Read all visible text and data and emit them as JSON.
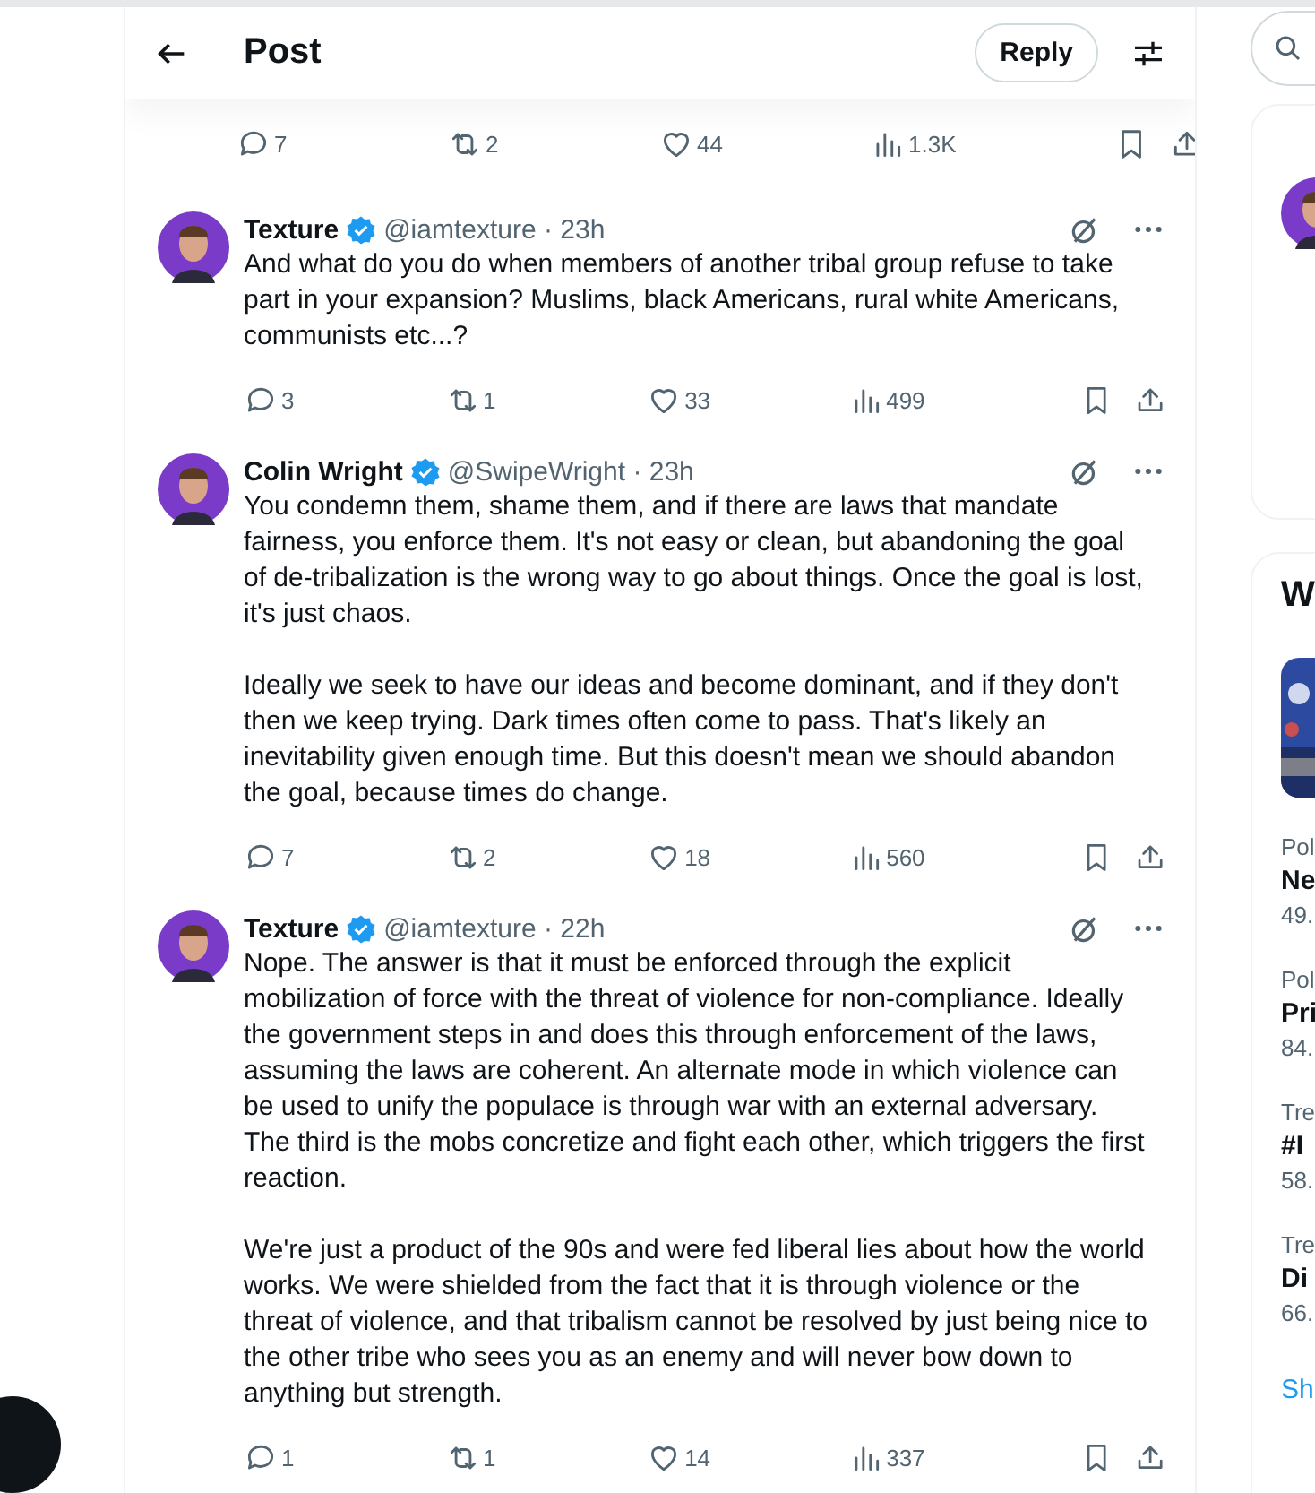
{
  "header": {
    "title": "Post",
    "reply_button": "Reply"
  },
  "tweets": [
    {
      "kind": "partial",
      "stats": {
        "replies": "7",
        "reposts": "2",
        "likes": "44",
        "views": "1.3K"
      }
    },
    {
      "kind": "full",
      "name": "Texture",
      "verified": true,
      "meta": "@iamtexture · 23h",
      "paragraphs": [
        "And what do you do when members of another tribal group refuse to take part in your expansion? Muslims, black Americans, rural white Americans, communists etc...?"
      ],
      "stats": {
        "replies": "3",
        "reposts": "1",
        "likes": "33",
        "views": "499"
      }
    },
    {
      "kind": "full",
      "name": "Colin Wright",
      "verified": true,
      "meta": "@SwipeWright · 23h",
      "paragraphs": [
        "You condemn them, shame them, and if there are laws that mandate fairness, you enforce them. It's not easy or clean, but abandoning the goal of de-tribalization is the wrong way to go about things. Once the goal is lost, it's just chaos.",
        "Ideally we seek to have our ideas and become dominant, and if they don't then we keep trying. Dark times often come to pass. That's likely an inevitability given enough time. But this doesn't mean we should abandon the goal, because times do change."
      ],
      "stats": {
        "replies": "7",
        "reposts": "2",
        "likes": "18",
        "views": "560"
      }
    },
    {
      "kind": "full",
      "name": "Texture",
      "verified": true,
      "meta": "@iamtexture · 22h",
      "paragraphs": [
        "Nope. The answer is that it must be enforced through the explicit mobilization of force with the threat of violence for non-compliance. Ideally the government steps in and does this through enforcement of the laws, assuming the laws are coherent. An alternate mode in which violence can be used to unify the populace is through war with an external adversary. The third is the mobs concretize and fight each other, which triggers the first reaction.",
        "We're just a product of the 90s and were fed liberal lies about how the world works. We were shielded from the fact that it is through violence or the threat of violence, and that tribalism cannot be resolved by just being nice to the other tribe who sees you as an enemy and will never bow down to anything but strength."
      ],
      "stats": {
        "replies": "1",
        "reposts": "1",
        "likes": "14",
        "views": "337"
      }
    }
  ],
  "sidebar": {
    "trends": {
      "title": "W",
      "items": [
        {
          "category": "Pol",
          "title": "Ne",
          "count": "49."
        },
        {
          "category": "Pol",
          "title": "Pri",
          "count": "84."
        },
        {
          "category": "Tre",
          "title": "#I",
          "count": "58."
        },
        {
          "category": "Tre",
          "title": "Di",
          "count": "66."
        }
      ],
      "show_more": "Sh"
    }
  }
}
